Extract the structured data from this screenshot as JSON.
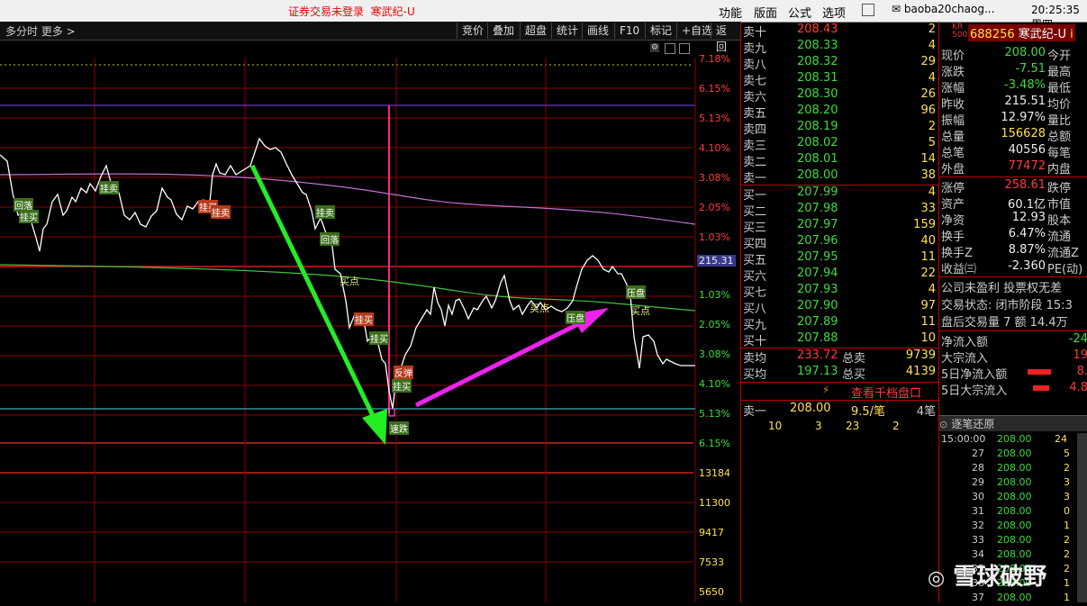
{
  "topbar": {
    "warning": "证券交易未登录",
    "stock": "寒武纪-U",
    "menu": [
      "功能",
      "版面",
      "公式",
      "选项"
    ],
    "account": "baoba20chaog...",
    "clock": "20:25:35 周四"
  },
  "toolbar": {
    "left": "多分时  更多 >",
    "buttons": [
      "竞价",
      "叠加",
      "超盘",
      "统计",
      "画线",
      "F10",
      "标记",
      "+自选",
      "返回"
    ]
  },
  "chart": {
    "pct_labels_red": [
      "7.18%",
      "6.15%",
      "5.13%",
      "4.10%",
      "3.08%",
      "2.05%",
      "1.03%"
    ],
    "price_tag": "215.31",
    "pct_labels_grn": [
      "1.03%",
      "2.05%",
      "3.08%",
      "4.10%",
      "5.13%",
      "6.15%"
    ],
    "vol_labels": [
      "13184",
      "11300",
      "9417",
      "7533",
      "5650"
    ],
    "markers": {
      "m1": "回落",
      "m2": "挂买",
      "m3": "挂卖",
      "m4": "挂买",
      "m5": "挂卖",
      "m6": "挂买",
      "m7": "挂卖",
      "m8": "回落",
      "m9": "买点",
      "m10": "挂买",
      "m11": "挂买",
      "m12": "反弹",
      "m13": "挂买",
      "m14": "速跌",
      "m15": "买点",
      "m16": "压盘",
      "m17": "压盘",
      "m18": "买点"
    }
  },
  "orderbook": {
    "asks": [
      {
        "label": "卖十",
        "price": "208.43",
        "vol": "2"
      },
      {
        "label": "卖九",
        "price": "208.33",
        "vol": "4"
      },
      {
        "label": "卖八",
        "price": "208.32",
        "vol": "29"
      },
      {
        "label": "卖七",
        "price": "208.31",
        "vol": "4"
      },
      {
        "label": "卖六",
        "price": "208.30",
        "vol": "26"
      },
      {
        "label": "卖五",
        "price": "208.20",
        "vol": "96"
      },
      {
        "label": "卖四",
        "price": "208.19",
        "vol": "2"
      },
      {
        "label": "卖三",
        "price": "208.02",
        "vol": "5"
      },
      {
        "label": "卖二",
        "price": "208.01",
        "vol": "14"
      },
      {
        "label": "卖一",
        "price": "208.00",
        "vol": "38"
      }
    ],
    "bids": [
      {
        "label": "买一",
        "price": "207.99",
        "vol": "4"
      },
      {
        "label": "买二",
        "price": "207.98",
        "vol": "33"
      },
      {
        "label": "买三",
        "price": "207.97",
        "vol": "159"
      },
      {
        "label": "买四",
        "price": "207.96",
        "vol": "40"
      },
      {
        "label": "买五",
        "price": "207.95",
        "vol": "11"
      },
      {
        "label": "买六",
        "price": "207.94",
        "vol": "22"
      },
      {
        "label": "买七",
        "price": "207.93",
        "vol": "4"
      },
      {
        "label": "买八",
        "price": "207.90",
        "vol": "97"
      },
      {
        "label": "买九",
        "price": "207.89",
        "vol": "11"
      },
      {
        "label": "买十",
        "price": "207.88",
        "vol": "10"
      }
    ],
    "ask_avg": {
      "label": "卖均",
      "price": "233.72",
      "l2": "总卖",
      "vol": "9739"
    },
    "bid_avg": {
      "label": "买均",
      "price": "197.13",
      "l2": "总买",
      "vol": "4139"
    },
    "more_link": "查看千档盘口",
    "ask1_row": {
      "label": "卖一",
      "price": "208.00",
      "per": "9.5/笔",
      "count": "4笔"
    },
    "ask1_sub": [
      "10",
      "3",
      "23",
      "2"
    ]
  },
  "quote": {
    "tag": "KR",
    "tag2": "500",
    "code": "688256",
    "name": "寒武纪-U",
    "rows": [
      {
        "l": "现价",
        "v": "208.00",
        "l2": "今开"
      },
      {
        "l": "涨跌",
        "v": "-7.51",
        "l2": "最高"
      },
      {
        "l": "涨幅",
        "v": "-3.48%",
        "l2": "最低"
      },
      {
        "l": "昨收",
        "v": "215.51",
        "l2": "均价"
      },
      {
        "l": "振幅",
        "v": "12.97%",
        "l2": "量比"
      },
      {
        "l": "总量",
        "v": "156628",
        "l2": "总额"
      },
      {
        "l": "总笔",
        "v": "40556",
        "l2": "每笔"
      },
      {
        "l": "外盘",
        "v": "77472",
        "l2": "内盘"
      },
      {
        "l": "涨停",
        "v": "258.61",
        "l2": "跌停"
      },
      {
        "l": "资产",
        "v": "60.1亿",
        "l2": "市值"
      },
      {
        "l": "净资",
        "v": "12.93",
        "l2": "股本"
      },
      {
        "l": "换手",
        "v": "6.47%",
        "l2": "流通"
      },
      {
        "l": "换手Z",
        "v": "8.87%",
        "l2": "流通Z"
      },
      {
        "l": "收益㈢",
        "v": "-2.360",
        "l2": "PE(动)"
      }
    ],
    "info1": "公司未盈利 投票权无差",
    "info2": "交易状态: 闭市阶段 15:3",
    "info3": "盘后交易量 7 额 14.4万",
    "flows": [
      {
        "l": "净流入额",
        "v": "-24"
      },
      {
        "l": "大宗流入",
        "v": "19"
      },
      {
        "l": "5日净流入额",
        "v": "8."
      },
      {
        "l": "5日大宗流入",
        "v": "4.8"
      }
    ],
    "trades_title": "逐笔还原",
    "trades": [
      {
        "t": "15:00:00",
        "p": "208.00",
        "v": "24"
      },
      {
        "t": "27",
        "p": "208.00",
        "v": "5"
      },
      {
        "t": "28",
        "p": "208.00",
        "v": "2"
      },
      {
        "t": "29",
        "p": "208.00",
        "v": "3"
      },
      {
        "t": "30",
        "p": "208.00",
        "v": "3"
      },
      {
        "t": "31",
        "p": "208.00",
        "v": "0"
      },
      {
        "t": "32",
        "p": "208.00",
        "v": "1"
      },
      {
        "t": "33",
        "p": "208.00",
        "v": "2"
      },
      {
        "t": "34",
        "p": "208.00",
        "v": "2"
      },
      {
        "t": "35",
        "p": "208.00",
        "v": "2"
      },
      {
        "t": "36",
        "p": "208.00",
        "v": "1"
      },
      {
        "t": "37",
        "p": "208.00",
        "v": "1"
      }
    ],
    "watermark": "雪球破野"
  }
}
